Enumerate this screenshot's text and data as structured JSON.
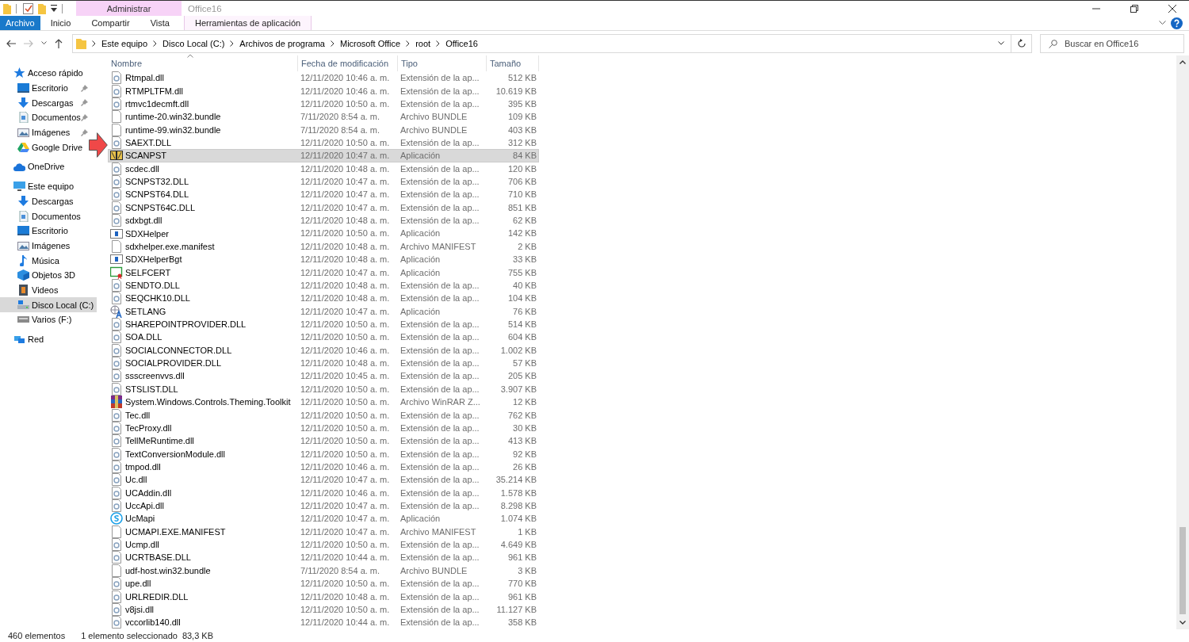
{
  "window": {
    "title": "Office16",
    "context_group": "Administrar"
  },
  "ribbon_tabs": [
    {
      "label": "Archivo",
      "kind": "file"
    },
    {
      "label": "Inicio",
      "kind": "plain"
    },
    {
      "label": "Compartir",
      "kind": "plain"
    },
    {
      "label": "Vista",
      "kind": "plain"
    },
    {
      "label": "Herramientas de aplicación",
      "kind": "context"
    }
  ],
  "address": {
    "crumbs": [
      "Este equipo",
      "Disco Local (C:)",
      "Archivos de programa",
      "Microsoft Office",
      "root",
      "Office16"
    ]
  },
  "search": {
    "placeholder": "Buscar en Office16"
  },
  "sidebar": {
    "items": [
      {
        "label": "Acceso rápido",
        "kind": "star",
        "selected": false,
        "children": [
          {
            "label": "Escritorio",
            "kind": "desktop",
            "pinned": true,
            "selected": false
          },
          {
            "label": "Descargas",
            "kind": "download",
            "pinned": true,
            "selected": false
          },
          {
            "label": "Documentos",
            "kind": "docs",
            "pinned": true,
            "selected": false
          },
          {
            "label": "Imágenes",
            "kind": "images",
            "pinned": true,
            "selected": false
          },
          {
            "label": "Google Drive",
            "kind": "gdrive",
            "pinned": false,
            "selected": false
          }
        ]
      },
      {
        "label": "OneDrive",
        "kind": "cloud",
        "selected": false
      },
      {
        "label": "Este equipo",
        "kind": "pc",
        "selected": false,
        "children": [
          {
            "label": "Descargas",
            "kind": "download",
            "pinned": false,
            "selected": false
          },
          {
            "label": "Documentos",
            "kind": "docs",
            "pinned": false,
            "selected": false
          },
          {
            "label": "Escritorio",
            "kind": "desktop",
            "pinned": false,
            "selected": false
          },
          {
            "label": "Imágenes",
            "kind": "images",
            "pinned": false,
            "selected": false
          },
          {
            "label": "Música",
            "kind": "music",
            "pinned": false,
            "selected": false
          },
          {
            "label": "Objetos 3D",
            "kind": "cube",
            "pinned": false,
            "selected": false
          },
          {
            "label": "Videos",
            "kind": "video",
            "pinned": false,
            "selected": false
          },
          {
            "label": "Disco Local (C:)",
            "kind": "drive",
            "pinned": false,
            "selected": true
          },
          {
            "label": "Varios (F:)",
            "kind": "usb",
            "pinned": false,
            "selected": false
          }
        ]
      },
      {
        "label": "Red",
        "kind": "network",
        "selected": false
      }
    ]
  },
  "table": {
    "columns": [
      {
        "label": "Nombre",
        "sorted": true
      },
      {
        "label": "Fecha de modificación",
        "sorted": false
      },
      {
        "label": "Tipo",
        "sorted": false
      },
      {
        "label": "Tamaño",
        "sorted": false
      }
    ],
    "rows": [
      {
        "name": "Rtmpal.dll",
        "modified": "12/11/2020 10:46 a. m.",
        "type": "Extensión de la ap...",
        "size": "512 KB",
        "kind": "dll",
        "selected": false
      },
      {
        "name": "RTMPLTFM.dll",
        "modified": "12/11/2020 10:46 a. m.",
        "type": "Extensión de la ap...",
        "size": "10.619 KB",
        "kind": "dll",
        "selected": false
      },
      {
        "name": "rtmvc1decmft.dll",
        "modified": "12/11/2020 10:50 a. m.",
        "type": "Extensión de la ap...",
        "size": "395 KB",
        "kind": "dll",
        "selected": false
      },
      {
        "name": "runtime-20.win32.bundle",
        "modified": "7/11/2020 8:54 a. m.",
        "type": "Archivo BUNDLE",
        "size": "109 KB",
        "kind": "blank",
        "selected": false
      },
      {
        "name": "runtime-99.win32.bundle",
        "modified": "7/11/2020 8:54 a. m.",
        "type": "Archivo BUNDLE",
        "size": "403 KB",
        "kind": "blank",
        "selected": false
      },
      {
        "name": "SAEXT.DLL",
        "modified": "12/11/2020 10:50 a. m.",
        "type": "Extensión de la ap...",
        "size": "312 KB",
        "kind": "dll",
        "selected": false
      },
      {
        "name": "SCANPST",
        "modified": "12/11/2020 10:47 a. m.",
        "type": "Aplicación",
        "size": "84 KB",
        "kind": "scan",
        "selected": true
      },
      {
        "name": "scdec.dll",
        "modified": "12/11/2020 10:48 a. m.",
        "type": "Extensión de la ap...",
        "size": "120 KB",
        "kind": "dll",
        "selected": false
      },
      {
        "name": "SCNPST32.DLL",
        "modified": "12/11/2020 10:47 a. m.",
        "type": "Extensión de la ap...",
        "size": "706 KB",
        "kind": "dll",
        "selected": false
      },
      {
        "name": "SCNPST64.DLL",
        "modified": "12/11/2020 10:47 a. m.",
        "type": "Extensión de la ap...",
        "size": "710 KB",
        "kind": "dll",
        "selected": false
      },
      {
        "name": "SCNPST64C.DLL",
        "modified": "12/11/2020 10:47 a. m.",
        "type": "Extensión de la ap...",
        "size": "851 KB",
        "kind": "dll",
        "selected": false
      },
      {
        "name": "sdxbgt.dll",
        "modified": "12/11/2020 10:48 a. m.",
        "type": "Extensión de la ap...",
        "size": "62 KB",
        "kind": "dll",
        "selected": false
      },
      {
        "name": "SDXHelper",
        "modified": "12/11/2020 10:50 a. m.",
        "type": "Aplicación",
        "size": "142 KB",
        "kind": "exe",
        "selected": false
      },
      {
        "name": "sdxhelper.exe.manifest",
        "modified": "12/11/2020 10:48 a. m.",
        "type": "Archivo MANIFEST",
        "size": "2 KB",
        "kind": "blank",
        "selected": false
      },
      {
        "name": "SDXHelperBgt",
        "modified": "12/11/2020 10:48 a. m.",
        "type": "Aplicación",
        "size": "33 KB",
        "kind": "exe",
        "selected": false
      },
      {
        "name": "SELFCERT",
        "modified": "12/11/2020 10:47 a. m.",
        "type": "Aplicación",
        "size": "755 KB",
        "kind": "cert",
        "selected": false
      },
      {
        "name": "SENDTO.DLL",
        "modified": "12/11/2020 10:48 a. m.",
        "type": "Extensión de la ap...",
        "size": "40 KB",
        "kind": "dll",
        "selected": false
      },
      {
        "name": "SEQCHK10.DLL",
        "modified": "12/11/2020 10:48 a. m.",
        "type": "Extensión de la ap...",
        "size": "104 KB",
        "kind": "dll",
        "selected": false
      },
      {
        "name": "SETLANG",
        "modified": "12/11/2020 10:47 a. m.",
        "type": "Aplicación",
        "size": "76 KB",
        "kind": "lang",
        "selected": false
      },
      {
        "name": "SHAREPOINTPROVIDER.DLL",
        "modified": "12/11/2020 10:50 a. m.",
        "type": "Extensión de la ap...",
        "size": "514 KB",
        "kind": "dll",
        "selected": false
      },
      {
        "name": "SOA.DLL",
        "modified": "12/11/2020 10:50 a. m.",
        "type": "Extensión de la ap...",
        "size": "604 KB",
        "kind": "dll",
        "selected": false
      },
      {
        "name": "SOCIALCONNECTOR.DLL",
        "modified": "12/11/2020 10:46 a. m.",
        "type": "Extensión de la ap...",
        "size": "1.002 KB",
        "kind": "dll",
        "selected": false
      },
      {
        "name": "SOCIALPROVIDER.DLL",
        "modified": "12/11/2020 10:48 a. m.",
        "type": "Extensión de la ap...",
        "size": "57 KB",
        "kind": "dll",
        "selected": false
      },
      {
        "name": "ssscreenvvs.dll",
        "modified": "12/11/2020 10:45 a. m.",
        "type": "Extensión de la ap...",
        "size": "205 KB",
        "kind": "dll",
        "selected": false
      },
      {
        "name": "STSLIST.DLL",
        "modified": "12/11/2020 10:50 a. m.",
        "type": "Extensión de la ap...",
        "size": "3.907 KB",
        "kind": "dll",
        "selected": false
      },
      {
        "name": "System.Windows.Controls.Theming.Toolkit",
        "modified": "12/11/2020 10:50 a. m.",
        "type": "Archivo WinRAR Z...",
        "size": "12 KB",
        "kind": "rar",
        "selected": false
      },
      {
        "name": "Tec.dll",
        "modified": "12/11/2020 10:50 a. m.",
        "type": "Extensión de la ap...",
        "size": "762 KB",
        "kind": "dll",
        "selected": false
      },
      {
        "name": "TecProxy.dll",
        "modified": "12/11/2020 10:50 a. m.",
        "type": "Extensión de la ap...",
        "size": "30 KB",
        "kind": "dll",
        "selected": false
      },
      {
        "name": "TellMeRuntime.dll",
        "modified": "12/11/2020 10:50 a. m.",
        "type": "Extensión de la ap...",
        "size": "413 KB",
        "kind": "dll",
        "selected": false
      },
      {
        "name": "TextConversionModule.dll",
        "modified": "12/11/2020 10:50 a. m.",
        "type": "Extensión de la ap...",
        "size": "92 KB",
        "kind": "dll",
        "selected": false
      },
      {
        "name": "tmpod.dll",
        "modified": "12/11/2020 10:46 a. m.",
        "type": "Extensión de la ap...",
        "size": "26 KB",
        "kind": "dll",
        "selected": false
      },
      {
        "name": "Uc.dll",
        "modified": "12/11/2020 10:47 a. m.",
        "type": "Extensión de la ap...",
        "size": "35.214 KB",
        "kind": "dll",
        "selected": false
      },
      {
        "name": "UCAddin.dll",
        "modified": "12/11/2020 10:46 a. m.",
        "type": "Extensión de la ap...",
        "size": "1.578 KB",
        "kind": "dll",
        "selected": false
      },
      {
        "name": "UccApi.dll",
        "modified": "12/11/2020 10:47 a. m.",
        "type": "Extensión de la ap...",
        "size": "8.298 KB",
        "kind": "dll",
        "selected": false
      },
      {
        "name": "UcMapi",
        "modified": "12/11/2020 10:47 a. m.",
        "type": "Aplicación",
        "size": "1.074 KB",
        "kind": "chat",
        "selected": false
      },
      {
        "name": "UCMAPI.EXE.MANIFEST",
        "modified": "12/11/2020 10:47 a. m.",
        "type": "Archivo MANIFEST",
        "size": "1 KB",
        "kind": "blank",
        "selected": false
      },
      {
        "name": "Ucmp.dll",
        "modified": "12/11/2020 10:50 a. m.",
        "type": "Extensión de la ap...",
        "size": "4.649 KB",
        "kind": "dll",
        "selected": false
      },
      {
        "name": "UCRTBASE.DLL",
        "modified": "12/11/2020 10:44 a. m.",
        "type": "Extensión de la ap...",
        "size": "961 KB",
        "kind": "dll",
        "selected": false
      },
      {
        "name": "udf-host.win32.bundle",
        "modified": "7/11/2020 8:54 a. m.",
        "type": "Archivo BUNDLE",
        "size": "3 KB",
        "kind": "blank",
        "selected": false
      },
      {
        "name": "upe.dll",
        "modified": "12/11/2020 10:50 a. m.",
        "type": "Extensión de la ap...",
        "size": "770 KB",
        "kind": "dll",
        "selected": false
      },
      {
        "name": "URLREDIR.DLL",
        "modified": "12/11/2020 10:48 a. m.",
        "type": "Extensión de la ap...",
        "size": "961 KB",
        "kind": "dll",
        "selected": false
      },
      {
        "name": "v8jsi.dll",
        "modified": "12/11/2020 10:50 a. m.",
        "type": "Extensión de la ap...",
        "size": "11.127 KB",
        "kind": "dll",
        "selected": false
      },
      {
        "name": "vccorlib140.dll",
        "modified": "12/11/2020 10:44 a. m.",
        "type": "Extensión de la ap...",
        "size": "358 KB",
        "kind": "dll",
        "selected": false
      }
    ]
  },
  "status_bar": {
    "count": "460 elementos",
    "selection": "1 elemento seleccionado",
    "selection_size": "83,3 KB"
  }
}
